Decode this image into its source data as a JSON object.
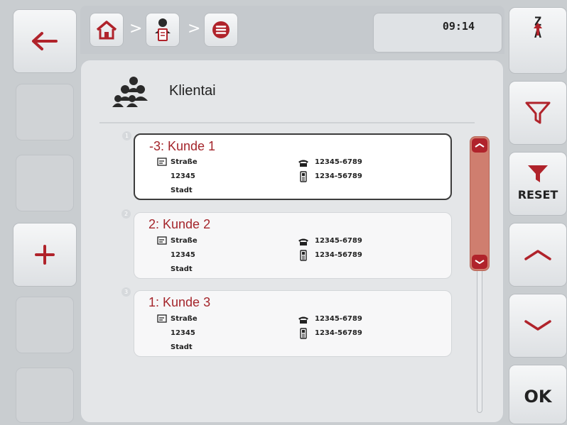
{
  "header": {
    "time": "09:14",
    "breadcrumb_separator": ">"
  },
  "panel": {
    "title": "Klientai"
  },
  "customers": [
    {
      "index": "1",
      "name": "-3: Kunde 1",
      "street": "Straße",
      "zip": "12345",
      "city": "Stadt",
      "phone": "12345-6789",
      "mobile": "1234-56789",
      "selected": true
    },
    {
      "index": "2",
      "name": "2: Kunde 2",
      "street": "Straße",
      "zip": "12345",
      "city": "Stadt",
      "phone": "12345-6789",
      "mobile": "1234-56789",
      "selected": false
    },
    {
      "index": "3",
      "name": "1: Kunde 3",
      "street": "Straße",
      "zip": "12345",
      "city": "Stadt",
      "phone": "12345-6789",
      "mobile": "1234-56789",
      "selected": false
    }
  ],
  "right_buttons": {
    "sort_top": "Z",
    "sort_bottom": "A",
    "reset_label": "RESET",
    "ok_label": "OK"
  },
  "colors": {
    "accent": "#a4252b",
    "scroll_thumb": "#cf7e6f",
    "background": "#c9cdd0"
  },
  "icons": {
    "back": "arrow-left-icon",
    "home": "home-icon",
    "customer_card": "customer-card-icon",
    "list": "list-icon",
    "group": "people-group-icon",
    "add": "plus-icon",
    "sort": "sort-z-a-icon",
    "filter": "filter-icon",
    "filter_reset": "filter-reset-icon",
    "up": "chevron-up-icon",
    "down": "chevron-down-icon",
    "address": "address-icon",
    "phone": "phone-icon",
    "mobile": "mobile-phone-icon"
  }
}
